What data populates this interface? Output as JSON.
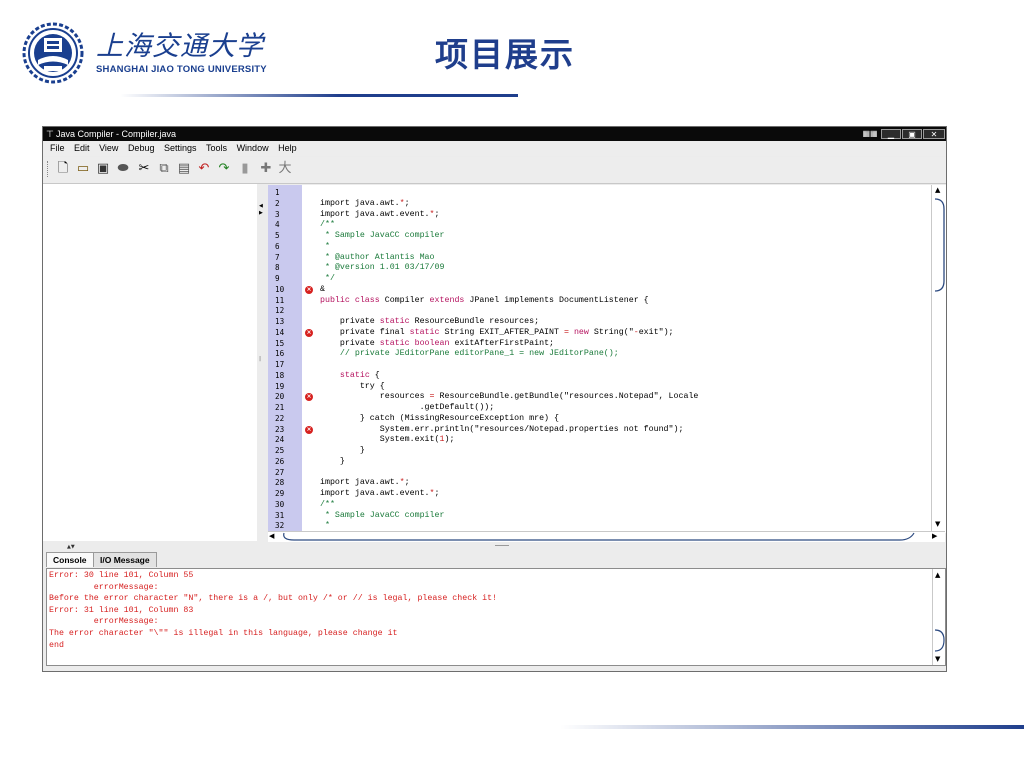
{
  "slide": {
    "title": "项目展示",
    "university_cn": "上海交通大学",
    "university_en": "SHANGHAI  JIAO TONG  UNIVERSITY",
    "accent_color": "#1f3e8c"
  },
  "window": {
    "title": "Java Compiler - Compiler.java",
    "app_icon": "tee-icon",
    "controls": [
      "grid-icon",
      "minimize-icon",
      "maximize-icon",
      "close-icon"
    ]
  },
  "menu": [
    "File",
    "Edit",
    "View",
    "Debug",
    "Settings",
    "Tools",
    "Window",
    "Help"
  ],
  "toolbar": [
    "new-file-icon",
    "open-folder-icon",
    "save-icon",
    "print-icon",
    "cut-icon",
    "copy-icon",
    "paste-icon",
    "undo-icon",
    "redo-icon",
    "page-icon",
    "add-icon",
    "run-icon"
  ],
  "editor": {
    "line_numbers": [
      "1",
      "2",
      "3",
      "4",
      "5",
      "6",
      "7",
      "8",
      "9",
      "10",
      "11",
      "12",
      "13",
      "14",
      "15",
      "16",
      "17",
      "18",
      "19",
      "20",
      "21",
      "22",
      "23",
      "24",
      "25",
      "26",
      "27",
      "28",
      "29",
      "30",
      "31",
      "32"
    ],
    "error_lines": [
      "10",
      "14",
      "20",
      "23"
    ],
    "lines": [
      {
        "n": "1",
        "segs": [
          {
            "t": "",
            "c": ""
          }
        ]
      },
      {
        "n": "2",
        "segs": [
          {
            "t": "import java.awt.",
            "c": ""
          },
          {
            "t": "*",
            "c": "nm"
          },
          {
            "t": ";",
            "c": ""
          }
        ]
      },
      {
        "n": "3",
        "segs": [
          {
            "t": "import java.awt.event.",
            "c": ""
          },
          {
            "t": "*",
            "c": "nm"
          },
          {
            "t": ";",
            "c": ""
          }
        ]
      },
      {
        "n": "4",
        "segs": [
          {
            "t": "/**",
            "c": "cm"
          }
        ]
      },
      {
        "n": "5",
        "segs": [
          {
            "t": " * Sample JavaCC compiler",
            "c": "cm"
          }
        ]
      },
      {
        "n": "6",
        "segs": [
          {
            "t": " *",
            "c": "cm"
          }
        ]
      },
      {
        "n": "7",
        "segs": [
          {
            "t": " * @author Atlantis Mao",
            "c": "cm"
          }
        ]
      },
      {
        "n": "8",
        "segs": [
          {
            "t": " * @version 1.01 03/17/09",
            "c": "cm"
          }
        ]
      },
      {
        "n": "9",
        "segs": [
          {
            "t": " */",
            "c": "cm"
          }
        ]
      },
      {
        "n": "10",
        "segs": [
          {
            "t": "&",
            "c": ""
          }
        ]
      },
      {
        "n": "11",
        "segs": [
          {
            "t": "public class",
            "c": "kw"
          },
          {
            "t": " Compiler ",
            "c": ""
          },
          {
            "t": "extends",
            "c": "kw"
          },
          {
            "t": " JPanel implements DocumentListener {",
            "c": ""
          }
        ]
      },
      {
        "n": "12",
        "segs": [
          {
            "t": "",
            "c": ""
          }
        ]
      },
      {
        "n": "13",
        "segs": [
          {
            "t": "    private ",
            "c": ""
          },
          {
            "t": "static",
            "c": "kw"
          },
          {
            "t": " ResourceBundle resources;",
            "c": ""
          }
        ]
      },
      {
        "n": "14",
        "segs": [
          {
            "t": "    private final ",
            "c": ""
          },
          {
            "t": "static",
            "c": "kw"
          },
          {
            "t": " String EXIT_AFTER_PAINT ",
            "c": ""
          },
          {
            "t": "=",
            "c": "nm"
          },
          {
            "t": " ",
            "c": ""
          },
          {
            "t": "new",
            "c": "kw"
          },
          {
            "t": " String(\"",
            "c": ""
          },
          {
            "t": "-",
            "c": "nm"
          },
          {
            "t": "exit\");",
            "c": ""
          }
        ]
      },
      {
        "n": "15",
        "segs": [
          {
            "t": "    private ",
            "c": ""
          },
          {
            "t": "static boolean",
            "c": "kw"
          },
          {
            "t": " exitAfterFirstPaint;",
            "c": ""
          }
        ]
      },
      {
        "n": "16",
        "segs": [
          {
            "t": "    // private JEditorPane editorPane_1 = new JEditorPane();",
            "c": "cm"
          }
        ]
      },
      {
        "n": "17",
        "segs": [
          {
            "t": "",
            "c": ""
          }
        ]
      },
      {
        "n": "18",
        "segs": [
          {
            "t": "    ",
            "c": ""
          },
          {
            "t": "static",
            "c": "kw"
          },
          {
            "t": " {",
            "c": ""
          }
        ]
      },
      {
        "n": "19",
        "segs": [
          {
            "t": "        try {",
            "c": ""
          }
        ]
      },
      {
        "n": "20",
        "segs": [
          {
            "t": "            resources ",
            "c": ""
          },
          {
            "t": "=",
            "c": "nm"
          },
          {
            "t": " ResourceBundle.getBundle(\"resources.Notepad\", Locale",
            "c": ""
          }
        ]
      },
      {
        "n": "21",
        "segs": [
          {
            "t": "                    .getDefault());",
            "c": ""
          }
        ]
      },
      {
        "n": "22",
        "segs": [
          {
            "t": "        } catch (MissingResourceException mre) {",
            "c": ""
          }
        ]
      },
      {
        "n": "23",
        "segs": [
          {
            "t": "            System.err.println(\"resources/Notepad.properties not found\");",
            "c": ""
          }
        ]
      },
      {
        "n": "24",
        "segs": [
          {
            "t": "            System.exit(",
            "c": ""
          },
          {
            "t": "1",
            "c": "nm"
          },
          {
            "t": ");",
            "c": ""
          }
        ]
      },
      {
        "n": "25",
        "segs": [
          {
            "t": "        }",
            "c": ""
          }
        ]
      },
      {
        "n": "26",
        "segs": [
          {
            "t": "    }",
            "c": ""
          }
        ]
      },
      {
        "n": "27",
        "segs": [
          {
            "t": "",
            "c": ""
          }
        ]
      },
      {
        "n": "28",
        "segs": [
          {
            "t": "import java.awt.",
            "c": ""
          },
          {
            "t": "*",
            "c": "nm"
          },
          {
            "t": ";",
            "c": ""
          }
        ]
      },
      {
        "n": "29",
        "segs": [
          {
            "t": "import java.awt.event.",
            "c": ""
          },
          {
            "t": "*",
            "c": "nm"
          },
          {
            "t": ";",
            "c": ""
          }
        ]
      },
      {
        "n": "30",
        "segs": [
          {
            "t": "/**",
            "c": "cm"
          }
        ]
      },
      {
        "n": "31",
        "segs": [
          {
            "t": " * Sample JavaCC compiler",
            "c": "cm"
          }
        ]
      },
      {
        "n": "32",
        "segs": [
          {
            "t": " *",
            "c": "cm"
          }
        ]
      }
    ],
    "colors": {
      "keyword": "#b5125f",
      "comment": "#1a7a3a",
      "literal": "#c81f1f",
      "gutter": "#c9c9ee",
      "error_marker": "#d6211f"
    }
  },
  "bottom_tabs": [
    "Console",
    "I/O Message"
  ],
  "console": {
    "color": "#d61f1f",
    "lines": [
      "Error: 30 line 101, Column 55",
      "         errorMessage:",
      "Before the error character \"N\", there is a /, but only /* or // is legal, please check it!",
      "Error: 31 line 101, Column 83",
      "         errorMessage:",
      "The error character \"\\\"\" is illegal in this language, please change it",
      "end"
    ]
  }
}
